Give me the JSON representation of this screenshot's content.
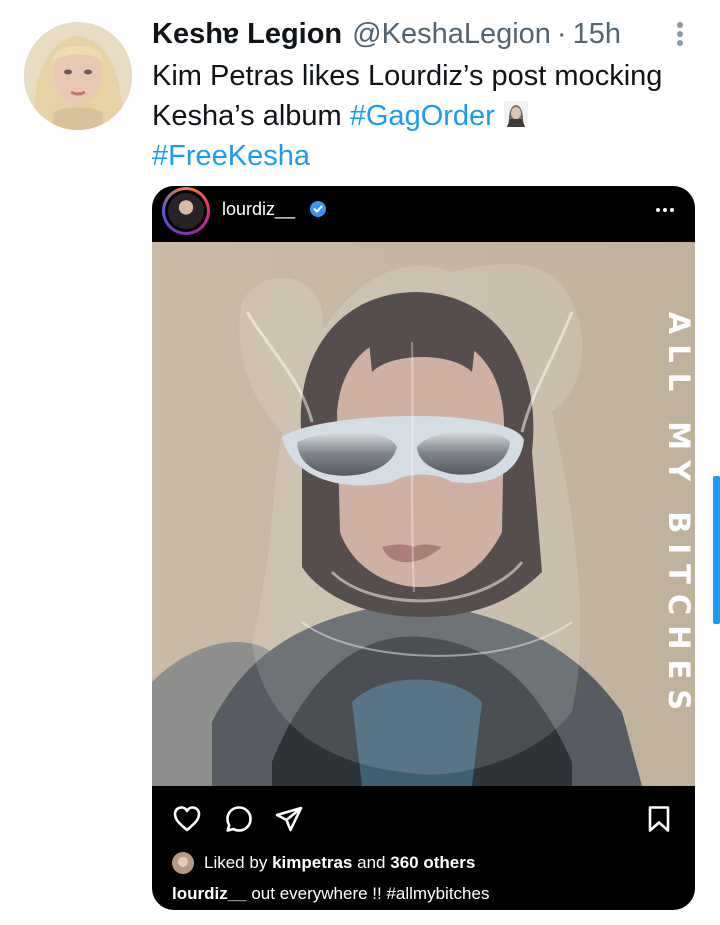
{
  "tweet": {
    "display_name": "Keshɐ Legion",
    "handle": "@KeshaLegion",
    "separator": "·",
    "time": "15h",
    "text_line1": "Kim Petras likes Lourdiz’s post mocking",
    "text_line2_prefix": "Kesha’s album ",
    "hashtag_1": "#GagOrder",
    "hashtag_2": "#FreeKesha",
    "emoji": "ghost-face-icon"
  },
  "instagram_post": {
    "username": "lourdiz__",
    "side_text": "ALL MY BITCHES",
    "liked_by_prefix": "Liked by ",
    "liked_by_user": "kimpetras",
    "liked_by_middle": " and ",
    "liked_by_others": "360 others",
    "caption_user": "lourdiz__",
    "caption_text": " out everywhere !! #allmybitches"
  },
  "colors": {
    "link": "#1d9bf0",
    "text": "#0f1419",
    "muted": "#536471",
    "card_bg": "#000000"
  }
}
